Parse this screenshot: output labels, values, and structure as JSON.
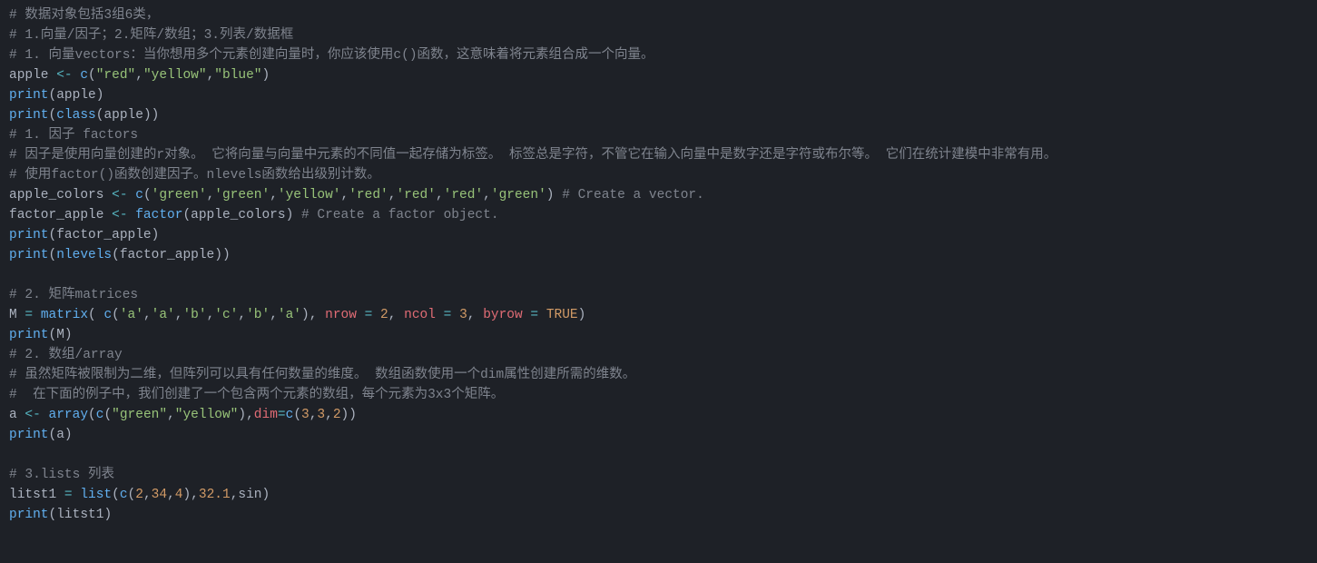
{
  "editor": {
    "language": "r",
    "lines": [
      [
        {
          "t": "comment",
          "v": "# 数据对象包括3组6类，"
        }
      ],
      [
        {
          "t": "comment",
          "v": "# 1.向量/因子；2.矩阵/数组；3.列表/数据框"
        }
      ],
      [
        {
          "t": "comment",
          "v": "# 1. 向量vectors：当你想用多个元素创建向量时，你应该使用c()函数，这意味着将元素组合成一个向量。"
        }
      ],
      [
        {
          "t": "ident",
          "v": "apple"
        },
        {
          "t": "punct",
          "v": " "
        },
        {
          "t": "op",
          "v": "<-"
        },
        {
          "t": "punct",
          "v": " "
        },
        {
          "t": "func",
          "v": "c"
        },
        {
          "t": "punct",
          "v": "("
        },
        {
          "t": "string",
          "v": "\"red\""
        },
        {
          "t": "punct",
          "v": ","
        },
        {
          "t": "string",
          "v": "\"yellow\""
        },
        {
          "t": "punct",
          "v": ","
        },
        {
          "t": "string",
          "v": "\"blue\""
        },
        {
          "t": "punct",
          "v": ")"
        }
      ],
      [
        {
          "t": "func",
          "v": "print"
        },
        {
          "t": "punct",
          "v": "("
        },
        {
          "t": "ident",
          "v": "apple"
        },
        {
          "t": "punct",
          "v": ")"
        }
      ],
      [
        {
          "t": "func",
          "v": "print"
        },
        {
          "t": "punct",
          "v": "("
        },
        {
          "t": "func",
          "v": "class"
        },
        {
          "t": "punct",
          "v": "("
        },
        {
          "t": "ident",
          "v": "apple"
        },
        {
          "t": "punct",
          "v": ")"
        },
        {
          "t": "punct",
          "v": ")"
        }
      ],
      [
        {
          "t": "comment",
          "v": "# 1. 因子 factors"
        }
      ],
      [
        {
          "t": "comment",
          "v": "# 因子是使用向量创建的r对象。 它将向量与向量中元素的不同值一起存储为标签。 标签总是字符，不管它在输入向量中是数字还是字符或布尔等。 它们在统计建模中非常有用。"
        }
      ],
      [
        {
          "t": "comment",
          "v": "# 使用factor()函数创建因子。nlevels函数给出级别计数。"
        }
      ],
      [
        {
          "t": "ident",
          "v": "apple_colors"
        },
        {
          "t": "punct",
          "v": " "
        },
        {
          "t": "op",
          "v": "<-"
        },
        {
          "t": "punct",
          "v": " "
        },
        {
          "t": "func",
          "v": "c"
        },
        {
          "t": "punct",
          "v": "("
        },
        {
          "t": "string",
          "v": "'green'"
        },
        {
          "t": "punct",
          "v": ","
        },
        {
          "t": "string",
          "v": "'green'"
        },
        {
          "t": "punct",
          "v": ","
        },
        {
          "t": "string",
          "v": "'yellow'"
        },
        {
          "t": "punct",
          "v": ","
        },
        {
          "t": "string",
          "v": "'red'"
        },
        {
          "t": "punct",
          "v": ","
        },
        {
          "t": "string",
          "v": "'red'"
        },
        {
          "t": "punct",
          "v": ","
        },
        {
          "t": "string",
          "v": "'red'"
        },
        {
          "t": "punct",
          "v": ","
        },
        {
          "t": "string",
          "v": "'green'"
        },
        {
          "t": "punct",
          "v": ") "
        },
        {
          "t": "comment",
          "v": "# Create a vector."
        }
      ],
      [
        {
          "t": "ident",
          "v": "factor_apple"
        },
        {
          "t": "punct",
          "v": " "
        },
        {
          "t": "op",
          "v": "<-"
        },
        {
          "t": "punct",
          "v": " "
        },
        {
          "t": "func",
          "v": "factor"
        },
        {
          "t": "punct",
          "v": "("
        },
        {
          "t": "ident",
          "v": "apple_colors"
        },
        {
          "t": "punct",
          "v": ") "
        },
        {
          "t": "comment",
          "v": "# Create a factor object."
        }
      ],
      [
        {
          "t": "func",
          "v": "print"
        },
        {
          "t": "punct",
          "v": "("
        },
        {
          "t": "ident",
          "v": "factor_apple"
        },
        {
          "t": "punct",
          "v": ")"
        }
      ],
      [
        {
          "t": "func",
          "v": "print"
        },
        {
          "t": "punct",
          "v": "("
        },
        {
          "t": "func",
          "v": "nlevels"
        },
        {
          "t": "punct",
          "v": "("
        },
        {
          "t": "ident",
          "v": "factor_apple"
        },
        {
          "t": "punct",
          "v": ")"
        },
        {
          "t": "punct",
          "v": ")"
        }
      ],
      [],
      [
        {
          "t": "comment",
          "v": "# 2. 矩阵matrices"
        }
      ],
      [
        {
          "t": "ident",
          "v": "M"
        },
        {
          "t": "punct",
          "v": " "
        },
        {
          "t": "op",
          "v": "="
        },
        {
          "t": "punct",
          "v": " "
        },
        {
          "t": "func",
          "v": "matrix"
        },
        {
          "t": "punct",
          "v": "( "
        },
        {
          "t": "func",
          "v": "c"
        },
        {
          "t": "punct",
          "v": "("
        },
        {
          "t": "string",
          "v": "'a'"
        },
        {
          "t": "punct",
          "v": ","
        },
        {
          "t": "string",
          "v": "'a'"
        },
        {
          "t": "punct",
          "v": ","
        },
        {
          "t": "string",
          "v": "'b'"
        },
        {
          "t": "punct",
          "v": ","
        },
        {
          "t": "string",
          "v": "'c'"
        },
        {
          "t": "punct",
          "v": ","
        },
        {
          "t": "string",
          "v": "'b'"
        },
        {
          "t": "punct",
          "v": ","
        },
        {
          "t": "string",
          "v": "'a'"
        },
        {
          "t": "punct",
          "v": "), "
        },
        {
          "t": "param",
          "v": "nrow"
        },
        {
          "t": "punct",
          "v": " "
        },
        {
          "t": "op",
          "v": "="
        },
        {
          "t": "punct",
          "v": " "
        },
        {
          "t": "num",
          "v": "2"
        },
        {
          "t": "punct",
          "v": ", "
        },
        {
          "t": "param",
          "v": "ncol"
        },
        {
          "t": "punct",
          "v": " "
        },
        {
          "t": "op",
          "v": "="
        },
        {
          "t": "punct",
          "v": " "
        },
        {
          "t": "num",
          "v": "3"
        },
        {
          "t": "punct",
          "v": ", "
        },
        {
          "t": "param",
          "v": "byrow"
        },
        {
          "t": "punct",
          "v": " "
        },
        {
          "t": "op",
          "v": "="
        },
        {
          "t": "punct",
          "v": " "
        },
        {
          "t": "bool",
          "v": "TRUE"
        },
        {
          "t": "punct",
          "v": ")"
        }
      ],
      [
        {
          "t": "func",
          "v": "print"
        },
        {
          "t": "punct",
          "v": "("
        },
        {
          "t": "ident",
          "v": "M"
        },
        {
          "t": "punct",
          "v": ")"
        }
      ],
      [
        {
          "t": "comment",
          "v": "# 2. 数组/array"
        }
      ],
      [
        {
          "t": "comment",
          "v": "# 虽然矩阵被限制为二维，但阵列可以具有任何数量的维度。 数组函数使用一个dim属性创建所需的维数。"
        }
      ],
      [
        {
          "t": "comment",
          "v": "#  在下面的例子中，我们创建了一个包含两个元素的数组，每个元素为3x3个矩阵。"
        }
      ],
      [
        {
          "t": "ident",
          "v": "a"
        },
        {
          "t": "punct",
          "v": " "
        },
        {
          "t": "op",
          "v": "<-"
        },
        {
          "t": "punct",
          "v": " "
        },
        {
          "t": "func",
          "v": "array"
        },
        {
          "t": "punct",
          "v": "("
        },
        {
          "t": "func",
          "v": "c"
        },
        {
          "t": "punct",
          "v": "("
        },
        {
          "t": "string",
          "v": "\"green\""
        },
        {
          "t": "punct",
          "v": ","
        },
        {
          "t": "string",
          "v": "\"yellow\""
        },
        {
          "t": "punct",
          "v": "),"
        },
        {
          "t": "param",
          "v": "dim"
        },
        {
          "t": "op",
          "v": "="
        },
        {
          "t": "func",
          "v": "c"
        },
        {
          "t": "punct",
          "v": "("
        },
        {
          "t": "num",
          "v": "3"
        },
        {
          "t": "punct",
          "v": ","
        },
        {
          "t": "num",
          "v": "3"
        },
        {
          "t": "punct",
          "v": ","
        },
        {
          "t": "num",
          "v": "2"
        },
        {
          "t": "punct",
          "v": ")"
        },
        {
          "t": "punct",
          "v": ")"
        }
      ],
      [
        {
          "t": "func",
          "v": "print"
        },
        {
          "t": "punct",
          "v": "("
        },
        {
          "t": "ident",
          "v": "a"
        },
        {
          "t": "punct",
          "v": ")"
        }
      ],
      [],
      [
        {
          "t": "comment",
          "v": "# 3.lists 列表"
        }
      ],
      [
        {
          "t": "ident",
          "v": "litst1"
        },
        {
          "t": "punct",
          "v": " "
        },
        {
          "t": "op",
          "v": "="
        },
        {
          "t": "punct",
          "v": " "
        },
        {
          "t": "func",
          "v": "list"
        },
        {
          "t": "punct",
          "v": "("
        },
        {
          "t": "func",
          "v": "c"
        },
        {
          "t": "punct",
          "v": "("
        },
        {
          "t": "num",
          "v": "2"
        },
        {
          "t": "punct",
          "v": ","
        },
        {
          "t": "num",
          "v": "34"
        },
        {
          "t": "punct",
          "v": ","
        },
        {
          "t": "num",
          "v": "4"
        },
        {
          "t": "punct",
          "v": "),"
        },
        {
          "t": "num",
          "v": "32.1"
        },
        {
          "t": "punct",
          "v": ","
        },
        {
          "t": "ident",
          "v": "sin"
        },
        {
          "t": "punct",
          "v": ")"
        }
      ],
      [
        {
          "t": "func",
          "v": "print"
        },
        {
          "t": "punct",
          "v": "("
        },
        {
          "t": "ident",
          "v": "litst1"
        },
        {
          "t": "punct",
          "v": ")"
        }
      ]
    ]
  }
}
